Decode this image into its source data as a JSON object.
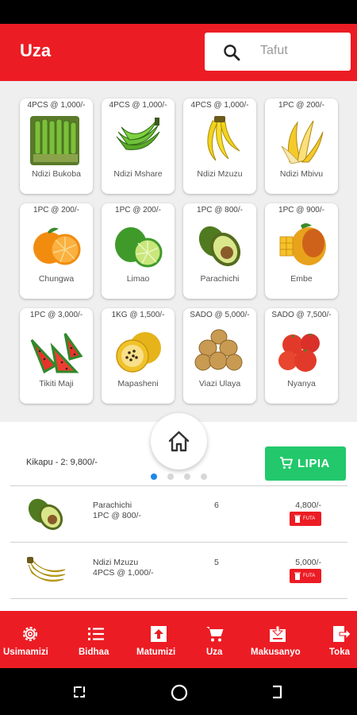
{
  "app": {
    "title": "Uza"
  },
  "search": {
    "placeholder": "Tafut"
  },
  "products": [
    {
      "price": "4PCS @ 1,000/-",
      "name": "Ndizi Bukoba",
      "icon": "green-banana-bunch-photo"
    },
    {
      "price": "4PCS @ 1,000/-",
      "name": "Ndizi Mshare",
      "icon": "green-banana-icon"
    },
    {
      "price": "4PCS @ 1,000/-",
      "name": "Ndizi Mzuzu",
      "icon": "yellow-banana-icon"
    },
    {
      "price": "1PC @ 200/-",
      "name": "Ndizi Mbivu",
      "icon": "peeled-banana-icon"
    },
    {
      "price": "1PC @ 200/-",
      "name": "Chungwa",
      "icon": "orange-icon"
    },
    {
      "price": "1PC @ 200/-",
      "name": "Limao",
      "icon": "lime-icon"
    },
    {
      "price": "1PC @ 800/-",
      "name": "Parachichi",
      "icon": "avocado-icon"
    },
    {
      "price": "1PC @ 900/-",
      "name": "Embe",
      "icon": "mango-icon"
    },
    {
      "price": "1PC @ 3,000/-",
      "name": "Tikiti Maji",
      "icon": "watermelon-icon"
    },
    {
      "price": "1KG @ 1,500/-",
      "name": "Mapasheni",
      "icon": "passion-fruit-icon"
    },
    {
      "price": "SADO @ 5,000/-",
      "name": "Viazi Ulaya",
      "icon": "potato-icon"
    },
    {
      "price": "SADO @ 7,500/-",
      "name": "Nyanya",
      "icon": "tomato-icon"
    }
  ],
  "pager": {
    "count": 4,
    "active": 0
  },
  "cart": {
    "total_label": "Kikapu - 2: 9,800/-",
    "pay_label": "LIPIA",
    "items": [
      {
        "name": "Parachichi",
        "unit": "1PC @ 800/-",
        "qty": "6",
        "amount": "4,800/-",
        "delete_label": "FUTA",
        "icon": "avocado-icon"
      },
      {
        "name": "Ndizi Mzuzu",
        "unit": "4PCS @ 1,000/-",
        "qty": "5",
        "amount": "5,000/-",
        "delete_label": "FUTA",
        "icon": "yellow-banana-icon"
      }
    ]
  },
  "nav": {
    "items": [
      {
        "label": "Usimamizi",
        "icon": "gear-icon"
      },
      {
        "label": "Bidhaa",
        "icon": "list-icon"
      },
      {
        "label": "Matumizi",
        "icon": "upload-icon"
      },
      {
        "label": "Uza",
        "icon": "cart-icon",
        "active": true
      },
      {
        "label": "Makusanyo",
        "icon": "download-icon"
      },
      {
        "label": "Toka",
        "icon": "logout-icon"
      }
    ]
  },
  "colors": {
    "primary": "#ec1c24",
    "pay": "#22c86b",
    "page_dot": "#2286e8"
  }
}
